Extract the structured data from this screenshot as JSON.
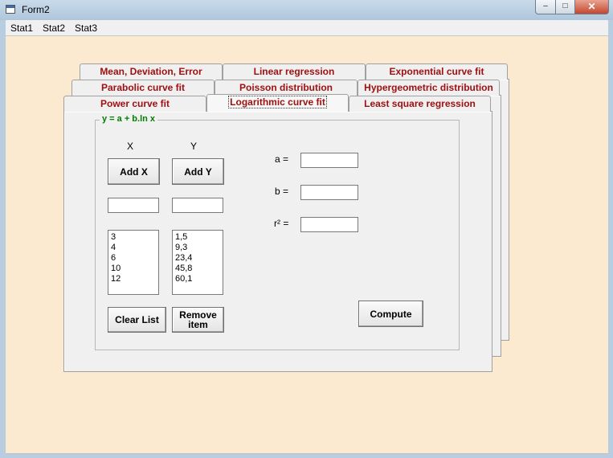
{
  "window": {
    "title": "Form2",
    "minimize": "–",
    "maximize": "□",
    "close": "✕"
  },
  "menu": [
    "Stat1",
    "Stat2",
    "Stat3"
  ],
  "tabs": {
    "row1": [
      "Mean, Deviation, Error",
      "Linear regression",
      "Exponential curve fit"
    ],
    "row2": [
      "Parabolic curve fit",
      "Poisson distribution",
      "Hypergeometric distribution"
    ],
    "row3": [
      "Power curve fit",
      "Logarithmic curve fit",
      "Least square regression"
    ]
  },
  "group": {
    "title": "y = a + b.ln x"
  },
  "x_col": {
    "header": "X",
    "button": "Add X",
    "input": "",
    "values": [
      "3",
      "4",
      "6",
      "10",
      "12"
    ]
  },
  "y_col": {
    "header": "Y",
    "button": "Add Y",
    "input": "",
    "values": [
      "1,5",
      "9,3",
      "23,4",
      "45,8",
      "60,1"
    ]
  },
  "results": {
    "a_label": "a =",
    "b_label": "b =",
    "r2_label": "r² =",
    "a": "",
    "b": "",
    "r2": ""
  },
  "buttons": {
    "clear": "Clear List",
    "remove": "Remove item",
    "compute": "Compute"
  }
}
